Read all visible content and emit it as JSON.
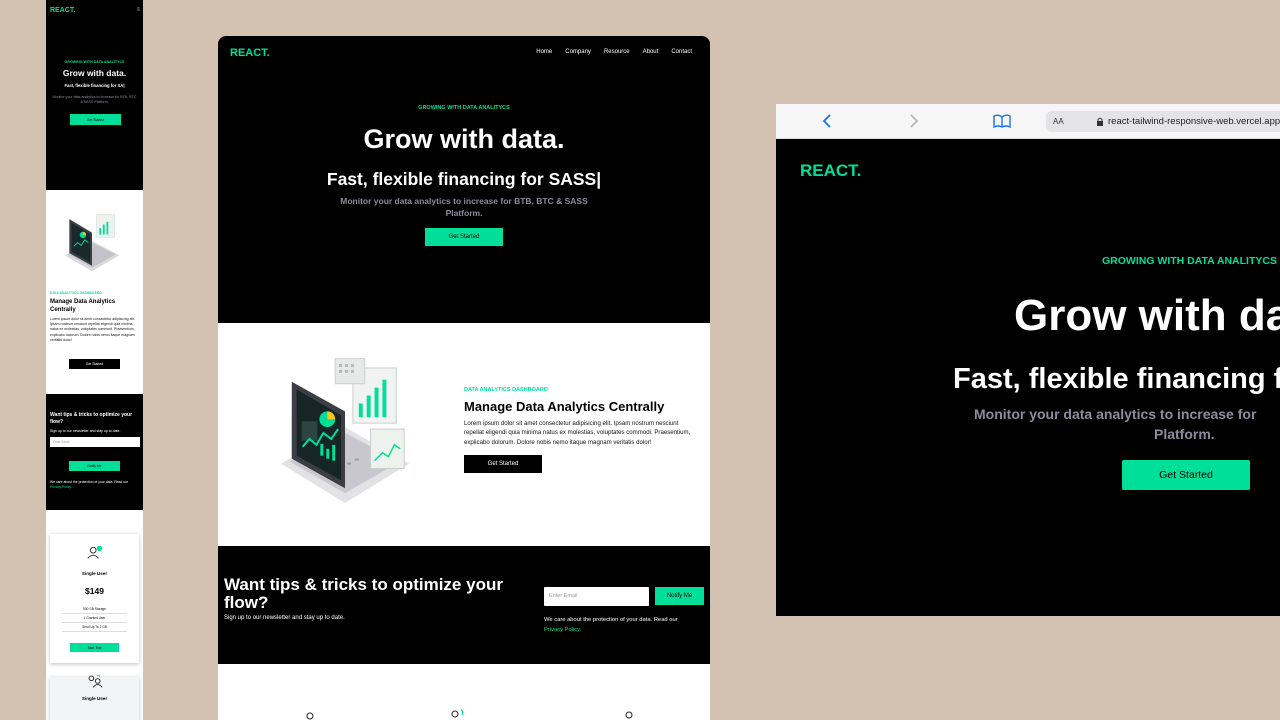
{
  "brand": {
    "logo": "REACT.",
    "accent": "#00df9a",
    "background": "#d3c1b2"
  },
  "nav": {
    "items": [
      "Home",
      "Company",
      "Resource",
      "About",
      "Contact"
    ]
  },
  "hero": {
    "eyebrow": "GROWING WITH DATA ANALITYCS",
    "title": "Grow with data.",
    "typed": "Fast, flexible financing for SASS|",
    "typed_mobile": "Fast, flexible financing for  SA|",
    "subtitle": "Monitor your data analytics to increase for BTB, BTC & SASS Platform.",
    "subtitle_line1": "Monitor your data analytics to increase for",
    "subtitle_line2": "Platform.",
    "cta": "Get Started"
  },
  "analytics": {
    "eyebrow": "DATA ANALYTICS DASHBOARD",
    "title": "Manage Data Analytics Centrally",
    "body": "Lorem ipsum dolor sit amet consectetur adipisicing elit. Ipsam nostrum nesciunt repellat eligendi quia minima natus ex molestias, voluptates commodi. Praesentium, explicabo dolorum. Dolore nobis nemo itaque magnam veritatis dolor!",
    "cta": "Get Started",
    "illustration": "laptop-dashboard-illustration"
  },
  "newsletter": {
    "title": "Want tips & tricks to optimize your flow?",
    "subtitle": "Sign up to our newsletter and stay up to date.",
    "input_placeholder": "Enter Email",
    "button": "Notify Me",
    "note": "We care about the protection of your data. Read our",
    "privacy_link": "Privacy Policy."
  },
  "pricing": {
    "cards": [
      {
        "title": "Single User",
        "price": "$149",
        "features": [
          "500 GB Storage",
          "1 Granted User",
          "Send Up To 2 GB"
        ],
        "button": "Start Trial",
        "icon": "single-user-icon"
      },
      {
        "title": "Single User",
        "icon": "double-user-icon"
      }
    ]
  },
  "browser": {
    "text_size": "AA",
    "url": "react-tailwind-responsive-web.vercel.app",
    "icons": [
      "back-arrow-icon",
      "forward-arrow-icon",
      "bookmarks-icon",
      "lock-icon"
    ]
  }
}
